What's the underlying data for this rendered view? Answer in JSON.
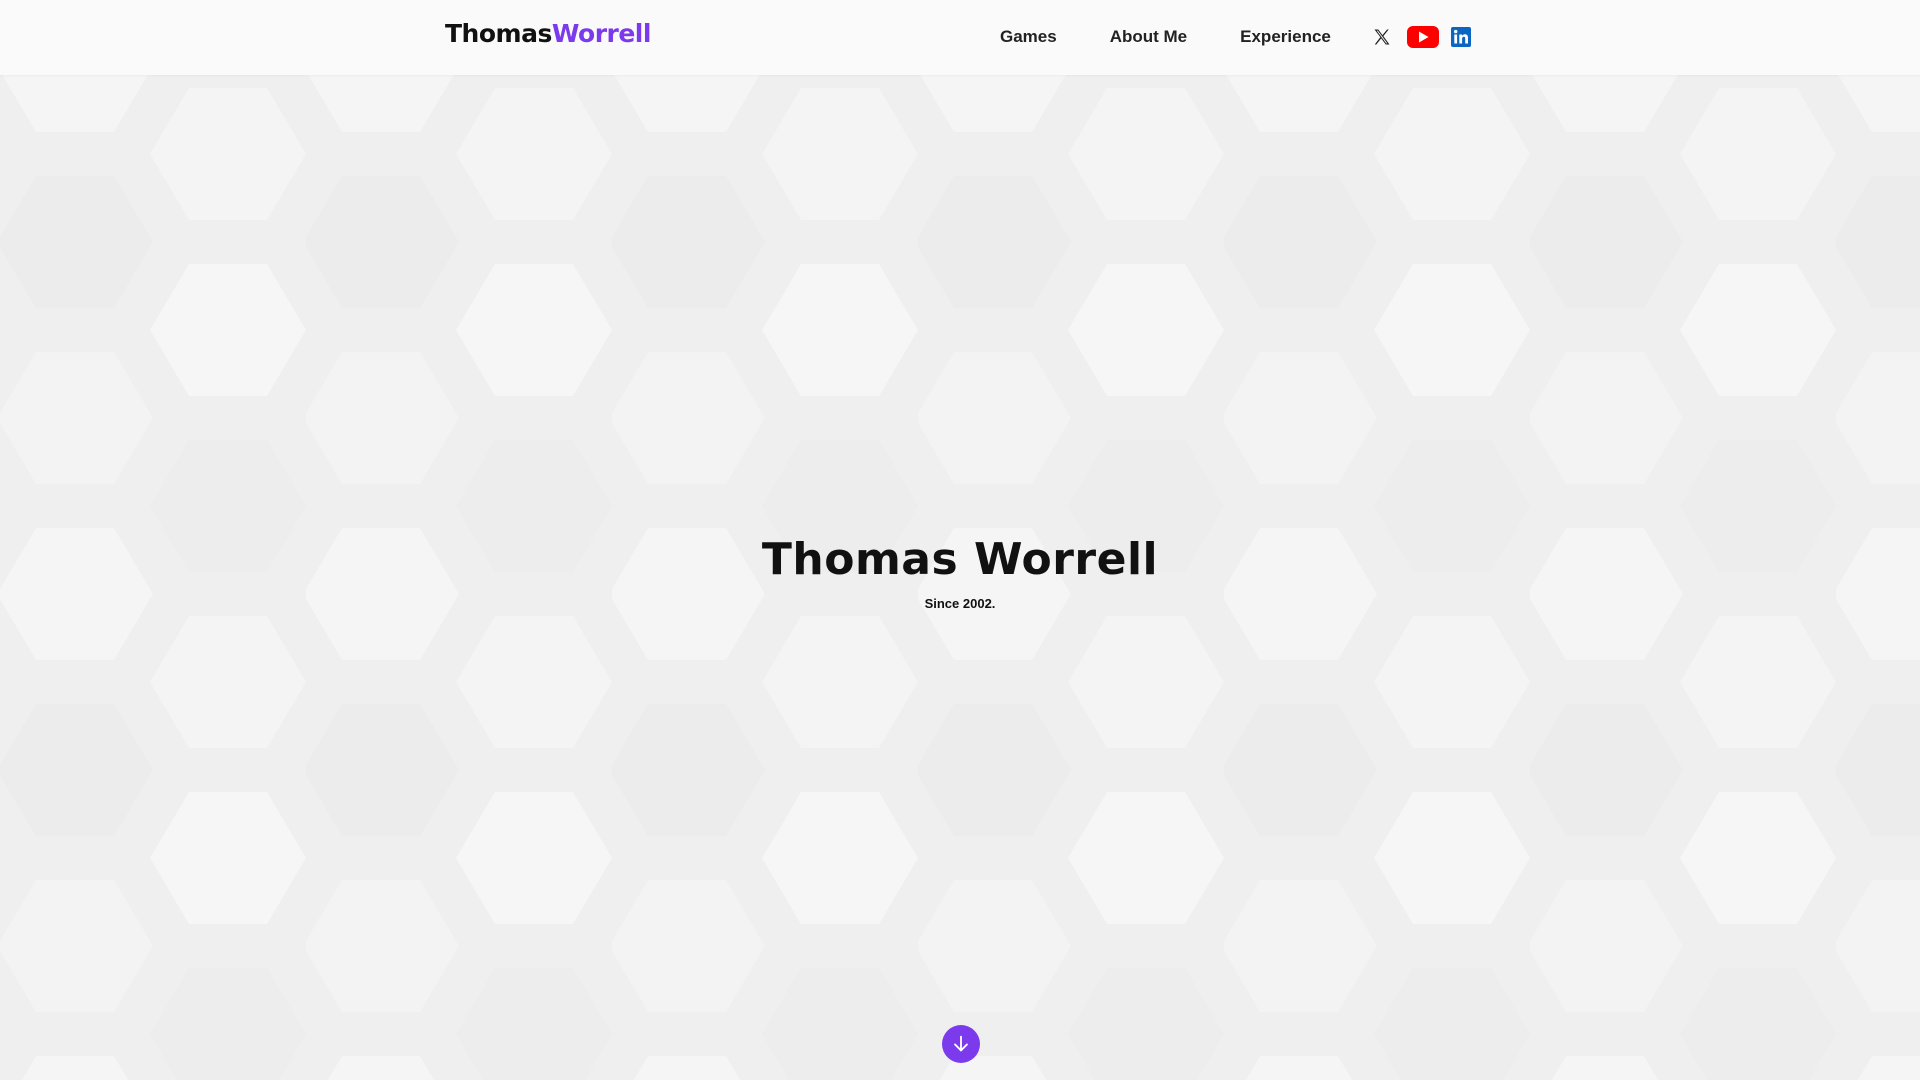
{
  "header": {
    "logo_part1": "Thomas",
    "logo_part2": "Worrell",
    "nav": [
      {
        "label": "Games"
      },
      {
        "label": "About Me"
      },
      {
        "label": "Experience"
      }
    ],
    "social": [
      "x-icon",
      "youtube-icon",
      "linkedin-icon"
    ]
  },
  "hero": {
    "title": "Thomas Worrell",
    "subtitle": "Since 2002."
  },
  "colors": {
    "accent": "#7c3aed",
    "youtube": "#ff0000",
    "linkedin": "#0a66c2",
    "background": "#f0f0f0"
  },
  "scroll_button_icon": "arrow-down-icon"
}
